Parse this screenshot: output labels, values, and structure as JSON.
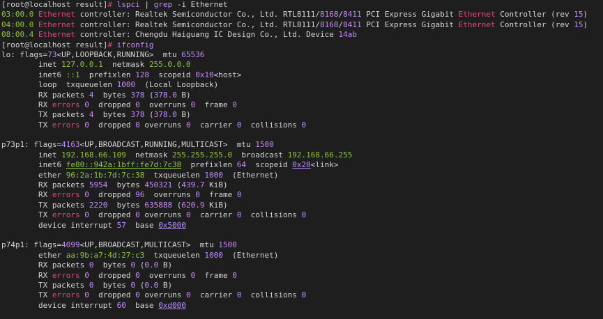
{
  "terminal": {
    "lines": [
      [
        {
          "t": "[root@localhost result]",
          "c": "prompt"
        },
        {
          "t": "# ",
          "c": "red"
        },
        {
          "t": "lspci ",
          "c": "num"
        },
        {
          "t": "| ",
          "c": "default"
        },
        {
          "t": "grep ",
          "c": "num"
        },
        {
          "t": "-i Ethernet",
          "c": "default"
        }
      ],
      [
        {
          "t": "03:00.0 ",
          "c": "green"
        },
        {
          "t": "Ethernet",
          "c": "red"
        },
        {
          "t": " controller: Realtek Semiconductor Co., Ltd. RTL8111/",
          "c": "default"
        },
        {
          "t": "8168",
          "c": "num"
        },
        {
          "t": "/",
          "c": "default"
        },
        {
          "t": "8411",
          "c": "num"
        },
        {
          "t": " PCI Express Gigabit ",
          "c": "default"
        },
        {
          "t": "Ethernet",
          "c": "red"
        },
        {
          "t": " Controller (rev ",
          "c": "default"
        },
        {
          "t": "15",
          "c": "num"
        },
        {
          "t": ")",
          "c": "default"
        }
      ],
      [
        {
          "t": "04:00.0 ",
          "c": "green"
        },
        {
          "t": "Ethernet",
          "c": "red"
        },
        {
          "t": " controller: Realtek Semiconductor Co., Ltd. RTL8111/",
          "c": "default"
        },
        {
          "t": "8168",
          "c": "num"
        },
        {
          "t": "/",
          "c": "default"
        },
        {
          "t": "8411",
          "c": "num"
        },
        {
          "t": " PCI Express Gigabit ",
          "c": "default"
        },
        {
          "t": "Ethernet",
          "c": "red"
        },
        {
          "t": " Controller (rev ",
          "c": "default"
        },
        {
          "t": "15",
          "c": "num"
        },
        {
          "t": ")",
          "c": "default"
        }
      ],
      [
        {
          "t": "08:00.4 ",
          "c": "green"
        },
        {
          "t": "Ethernet",
          "c": "red"
        },
        {
          "t": " controller: Chengdu Haiguang IC Design Co., Ltd. Device ",
          "c": "default"
        },
        {
          "t": "14ab",
          "c": "num"
        }
      ],
      [
        {
          "t": "[root@localhost result]",
          "c": "prompt"
        },
        {
          "t": "# ",
          "c": "red"
        },
        {
          "t": "ifconfig",
          "c": "num"
        }
      ],
      [
        {
          "t": "lo: flags=",
          "c": "default"
        },
        {
          "t": "73",
          "c": "num"
        },
        {
          "t": "<UP,LOOPBACK,RUNNING>  mtu ",
          "c": "default"
        },
        {
          "t": "65536",
          "c": "num"
        }
      ],
      [
        {
          "t": "        inet ",
          "c": "default"
        },
        {
          "t": "127.0.0.1",
          "c": "green"
        },
        {
          "t": "  netmask ",
          "c": "default"
        },
        {
          "t": "255.0.0.0",
          "c": "green"
        }
      ],
      [
        {
          "t": "        inet6 ",
          "c": "default"
        },
        {
          "t": "::1",
          "c": "green"
        },
        {
          "t": "  prefixlen ",
          "c": "default"
        },
        {
          "t": "128",
          "c": "num"
        },
        {
          "t": "  scopeid ",
          "c": "default"
        },
        {
          "t": "0x10",
          "c": "num"
        },
        {
          "t": "<host>",
          "c": "default"
        }
      ],
      [
        {
          "t": "        loop  txqueuelen ",
          "c": "default"
        },
        {
          "t": "1000",
          "c": "num"
        },
        {
          "t": "  (Local Loopback)",
          "c": "default"
        }
      ],
      [
        {
          "t": "        RX packets ",
          "c": "default"
        },
        {
          "t": "4",
          "c": "num"
        },
        {
          "t": "  bytes ",
          "c": "default"
        },
        {
          "t": "378",
          "c": "num"
        },
        {
          "t": " (",
          "c": "default"
        },
        {
          "t": "378.0",
          "c": "num"
        },
        {
          "t": " B)",
          "c": "default"
        }
      ],
      [
        {
          "t": "        RX ",
          "c": "default"
        },
        {
          "t": "errors",
          "c": "red"
        },
        {
          "t": " ",
          "c": "default"
        },
        {
          "t": "0",
          "c": "num"
        },
        {
          "t": "  dropped ",
          "c": "default"
        },
        {
          "t": "0",
          "c": "num"
        },
        {
          "t": "  overruns ",
          "c": "default"
        },
        {
          "t": "0",
          "c": "num"
        },
        {
          "t": "  frame ",
          "c": "default"
        },
        {
          "t": "0",
          "c": "num"
        }
      ],
      [
        {
          "t": "        TX packets ",
          "c": "default"
        },
        {
          "t": "4",
          "c": "num"
        },
        {
          "t": "  bytes ",
          "c": "default"
        },
        {
          "t": "378",
          "c": "num"
        },
        {
          "t": " (",
          "c": "default"
        },
        {
          "t": "378.0",
          "c": "num"
        },
        {
          "t": " B)",
          "c": "default"
        }
      ],
      [
        {
          "t": "        TX ",
          "c": "default"
        },
        {
          "t": "errors",
          "c": "red"
        },
        {
          "t": " ",
          "c": "default"
        },
        {
          "t": "0",
          "c": "num"
        },
        {
          "t": "  dropped ",
          "c": "default"
        },
        {
          "t": "0",
          "c": "num"
        },
        {
          "t": " overruns ",
          "c": "default"
        },
        {
          "t": "0",
          "c": "num"
        },
        {
          "t": "  carrier ",
          "c": "default"
        },
        {
          "t": "0",
          "c": "num"
        },
        {
          "t": "  collisions ",
          "c": "default"
        },
        {
          "t": "0",
          "c": "num"
        }
      ],
      [],
      [
        {
          "t": "p73p1: flags=",
          "c": "default"
        },
        {
          "t": "4163",
          "c": "num"
        },
        {
          "t": "<UP,BROADCAST,RUNNING,MULTICAST>  mtu ",
          "c": "default"
        },
        {
          "t": "1500",
          "c": "num"
        }
      ],
      [
        {
          "t": "        inet ",
          "c": "default"
        },
        {
          "t": "192.168.66.109",
          "c": "green"
        },
        {
          "t": "  netmask ",
          "c": "default"
        },
        {
          "t": "255.255.255.0",
          "c": "green"
        },
        {
          "t": "  broadcast ",
          "c": "default"
        },
        {
          "t": "192.168.66.255",
          "c": "green"
        }
      ],
      [
        {
          "t": "        inet6 ",
          "c": "default"
        },
        {
          "t": "fe80::942a:1bff:fe7d:7c38",
          "c": "green-ul"
        },
        {
          "t": "  prefixlen ",
          "c": "default"
        },
        {
          "t": "64",
          "c": "num"
        },
        {
          "t": "  scopeid ",
          "c": "default"
        },
        {
          "t": "0x20",
          "c": "purple-ul"
        },
        {
          "t": "<link>",
          "c": "default"
        }
      ],
      [
        {
          "t": "        ether ",
          "c": "default"
        },
        {
          "t": "96:2a:1b:7d:7c:38",
          "c": "green"
        },
        {
          "t": "  txqueuelen ",
          "c": "default"
        },
        {
          "t": "1000",
          "c": "num"
        },
        {
          "t": "  (Ethernet)",
          "c": "default"
        }
      ],
      [
        {
          "t": "        RX packets ",
          "c": "default"
        },
        {
          "t": "5954",
          "c": "num"
        },
        {
          "t": "  bytes ",
          "c": "default"
        },
        {
          "t": "450321",
          "c": "num"
        },
        {
          "t": " (",
          "c": "default"
        },
        {
          "t": "439.7",
          "c": "num"
        },
        {
          "t": " KiB)",
          "c": "default"
        }
      ],
      [
        {
          "t": "        RX ",
          "c": "default"
        },
        {
          "t": "errors",
          "c": "red"
        },
        {
          "t": " ",
          "c": "default"
        },
        {
          "t": "0",
          "c": "num"
        },
        {
          "t": "  dropped ",
          "c": "default"
        },
        {
          "t": "96",
          "c": "num"
        },
        {
          "t": "  overruns ",
          "c": "default"
        },
        {
          "t": "0",
          "c": "num"
        },
        {
          "t": "  frame ",
          "c": "default"
        },
        {
          "t": "0",
          "c": "num"
        }
      ],
      [
        {
          "t": "        TX packets ",
          "c": "default"
        },
        {
          "t": "2220",
          "c": "num"
        },
        {
          "t": "  bytes ",
          "c": "default"
        },
        {
          "t": "635888",
          "c": "num"
        },
        {
          "t": " (",
          "c": "default"
        },
        {
          "t": "620.9",
          "c": "num"
        },
        {
          "t": " KiB)",
          "c": "default"
        }
      ],
      [
        {
          "t": "        TX ",
          "c": "default"
        },
        {
          "t": "errors",
          "c": "red"
        },
        {
          "t": " ",
          "c": "default"
        },
        {
          "t": "0",
          "c": "num"
        },
        {
          "t": "  dropped ",
          "c": "default"
        },
        {
          "t": "0",
          "c": "num"
        },
        {
          "t": " overruns ",
          "c": "default"
        },
        {
          "t": "0",
          "c": "num"
        },
        {
          "t": "  carrier ",
          "c": "default"
        },
        {
          "t": "0",
          "c": "num"
        },
        {
          "t": "  collisions ",
          "c": "default"
        },
        {
          "t": "0",
          "c": "num"
        }
      ],
      [
        {
          "t": "        device interrupt ",
          "c": "default"
        },
        {
          "t": "57",
          "c": "num"
        },
        {
          "t": "  base ",
          "c": "default"
        },
        {
          "t": "0x5000",
          "c": "purple-ul"
        }
      ],
      [],
      [
        {
          "t": "p74p1: flags=",
          "c": "default"
        },
        {
          "t": "4099",
          "c": "num"
        },
        {
          "t": "<UP,BROADCAST,MULTICAST>  mtu ",
          "c": "default"
        },
        {
          "t": "1500",
          "c": "num"
        }
      ],
      [
        {
          "t": "        ether ",
          "c": "default"
        },
        {
          "t": "aa:9b:a7:4d:27:c3",
          "c": "green"
        },
        {
          "t": "  txqueuelen ",
          "c": "default"
        },
        {
          "t": "1000",
          "c": "num"
        },
        {
          "t": "  (Ethernet)",
          "c": "default"
        }
      ],
      [
        {
          "t": "        RX packets ",
          "c": "default"
        },
        {
          "t": "0",
          "c": "num"
        },
        {
          "t": "  bytes ",
          "c": "default"
        },
        {
          "t": "0",
          "c": "num"
        },
        {
          "t": " (",
          "c": "default"
        },
        {
          "t": "0.0",
          "c": "num"
        },
        {
          "t": " B)",
          "c": "default"
        }
      ],
      [
        {
          "t": "        RX ",
          "c": "default"
        },
        {
          "t": "errors",
          "c": "red"
        },
        {
          "t": " ",
          "c": "default"
        },
        {
          "t": "0",
          "c": "num"
        },
        {
          "t": "  dropped ",
          "c": "default"
        },
        {
          "t": "0",
          "c": "num"
        },
        {
          "t": "  overruns ",
          "c": "default"
        },
        {
          "t": "0",
          "c": "num"
        },
        {
          "t": "  frame ",
          "c": "default"
        },
        {
          "t": "0",
          "c": "num"
        }
      ],
      [
        {
          "t": "        TX packets ",
          "c": "default"
        },
        {
          "t": "0",
          "c": "num"
        },
        {
          "t": "  bytes ",
          "c": "default"
        },
        {
          "t": "0",
          "c": "num"
        },
        {
          "t": " (",
          "c": "default"
        },
        {
          "t": "0.0",
          "c": "num"
        },
        {
          "t": " B)",
          "c": "default"
        }
      ],
      [
        {
          "t": "        TX ",
          "c": "default"
        },
        {
          "t": "errors",
          "c": "red"
        },
        {
          "t": " ",
          "c": "default"
        },
        {
          "t": "0",
          "c": "num"
        },
        {
          "t": "  dropped ",
          "c": "default"
        },
        {
          "t": "0",
          "c": "num"
        },
        {
          "t": " overruns ",
          "c": "default"
        },
        {
          "t": "0",
          "c": "num"
        },
        {
          "t": "  carrier ",
          "c": "default"
        },
        {
          "t": "0",
          "c": "num"
        },
        {
          "t": "  collisions ",
          "c": "default"
        },
        {
          "t": "0",
          "c": "num"
        }
      ],
      [
        {
          "t": "        device interrupt ",
          "c": "default"
        },
        {
          "t": "60",
          "c": "num"
        },
        {
          "t": "  base ",
          "c": "default"
        },
        {
          "t": "0xd000",
          "c": "purple-ul"
        }
      ]
    ]
  }
}
